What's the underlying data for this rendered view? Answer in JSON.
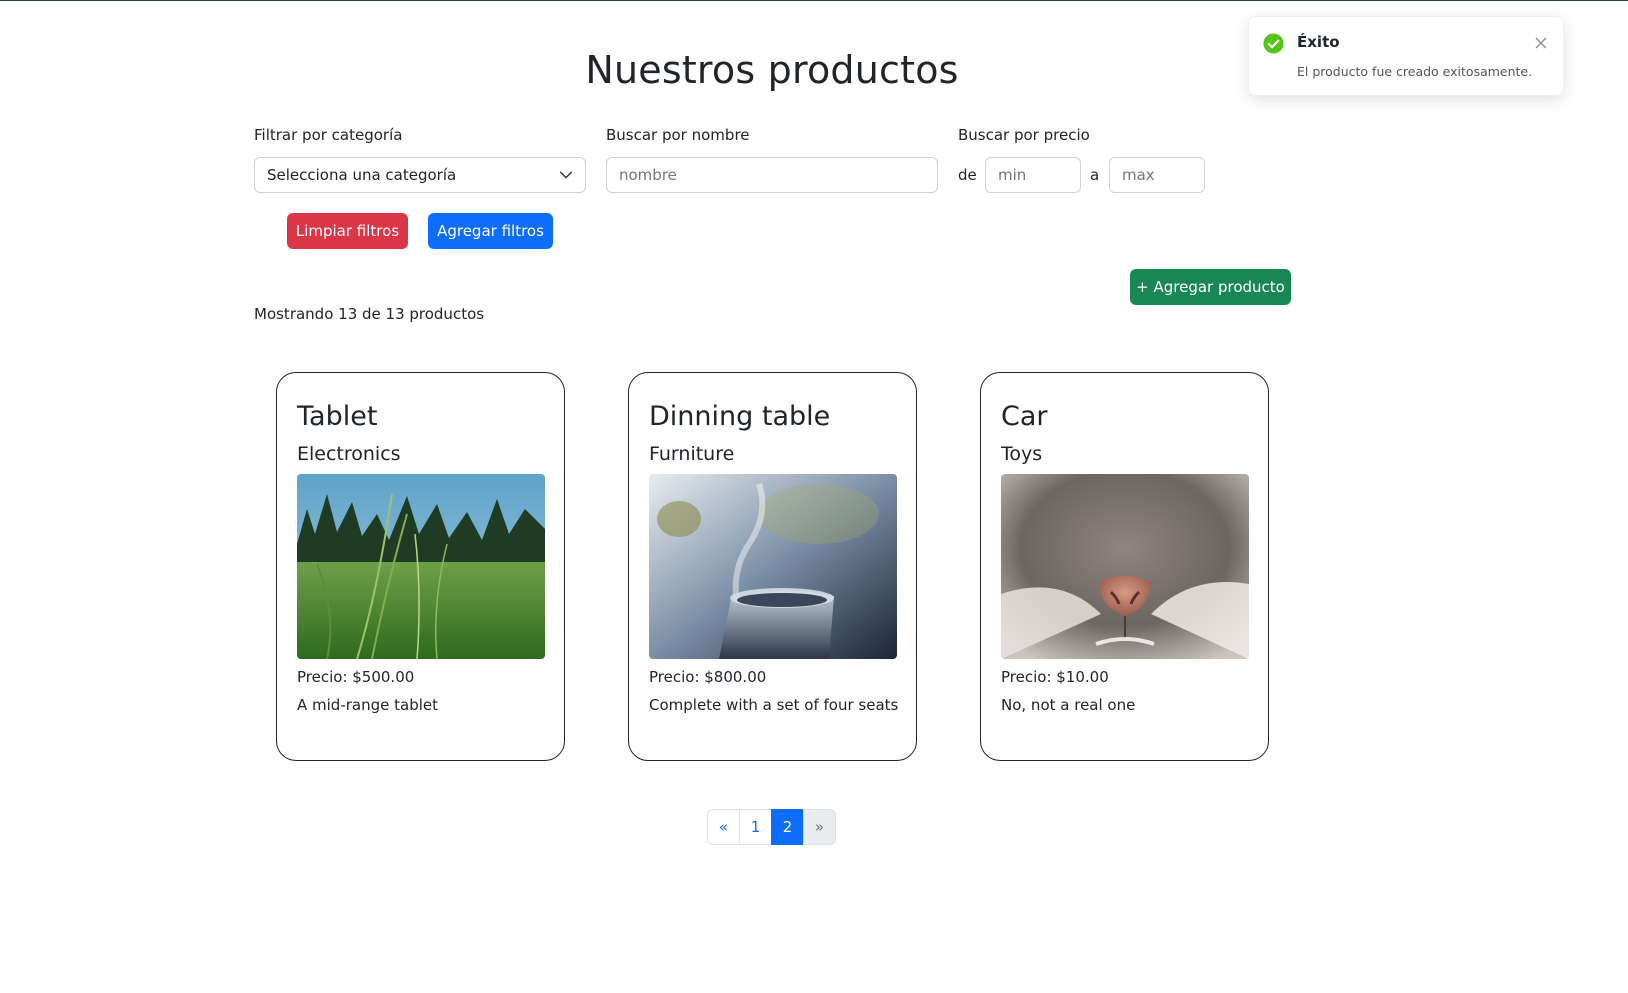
{
  "page": {
    "title": "Nuestros productos"
  },
  "filters": {
    "category_label": "Filtrar por categoría",
    "category_value": "Selecciona una categoría",
    "name_label": "Buscar por nombre",
    "name_placeholder": "nombre",
    "price_label": "Buscar por precio",
    "price_from": "de",
    "price_to": "a",
    "min_placeholder": "min",
    "max_placeholder": "max",
    "clear_label": "Limpiar filtros",
    "apply_label": "Agregar filtros"
  },
  "actions": {
    "add_product_label": "+ Agregar producto"
  },
  "results": {
    "count_text": "Mostrando 13 de 13 productos"
  },
  "products": [
    {
      "name": "Tablet",
      "category": "Electronics",
      "price": "Precio: $500.00",
      "description": "A mid-range tablet",
      "image": "grass-field-photo"
    },
    {
      "name": "Dinning table",
      "category": "Furniture",
      "price": "Precio: $800.00",
      "description": "Complete with a set of four seats",
      "image": "steaming-mug-photo"
    },
    {
      "name": "Car",
      "category": "Toys",
      "price": "Precio: $10.00",
      "description": "No, not a real one",
      "image": "cat-nose-photo"
    }
  ],
  "pagination": {
    "prev": "«",
    "pages": [
      "1",
      "2"
    ],
    "active_page": "2",
    "next": "»"
  },
  "toast": {
    "title": "Éxito",
    "message": "El producto fue creado exitosamente.",
    "icon": "check-circle-icon"
  },
  "colors": {
    "danger": "#dc3545",
    "primary": "#0d6efd",
    "success": "#198754",
    "toast_icon": "#52c41a"
  }
}
